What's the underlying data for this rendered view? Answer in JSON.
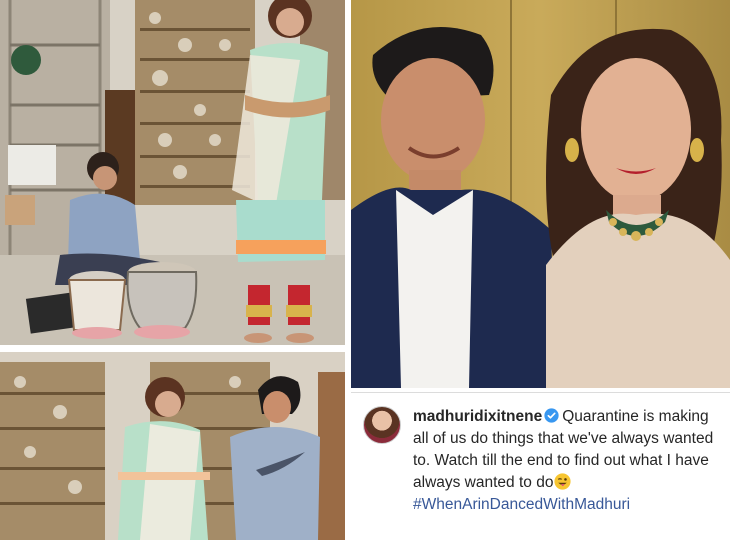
{
  "caption": {
    "username": "madhuridixitnene",
    "text": "Quarantine is making all of us do things that we've always wanted to. Watch till the end to find out what I have always wanted to do",
    "hashtag": "#WhenArinDancedWithMadhuri",
    "verified": true,
    "emoji_icon": "winking-tongue-face-icon"
  },
  "colors": {
    "hashtag": "#385898",
    "verified_badge": "#3897f0",
    "text": "#262626"
  }
}
